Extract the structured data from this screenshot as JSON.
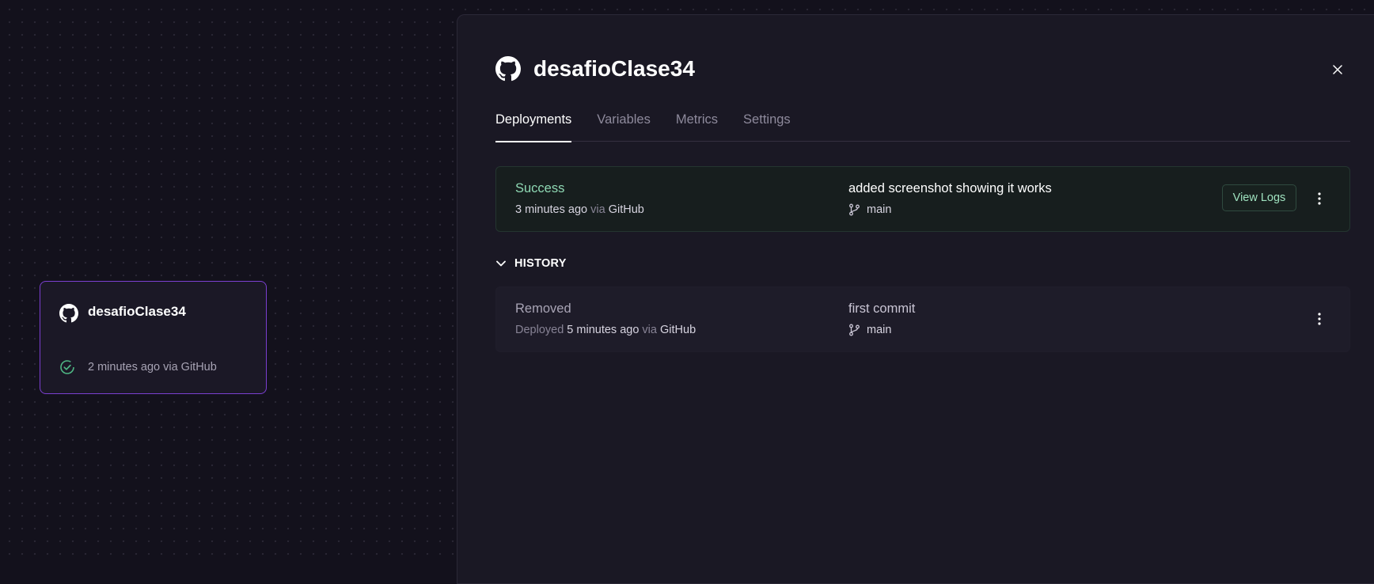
{
  "colors": {
    "success": "#8fd9b4",
    "accent_border": "#7b3fd0",
    "removed": "#a8a4b5"
  },
  "service_card": {
    "name": "desafioClase34",
    "icon": "github-icon",
    "status_icon": "check-circle-icon",
    "meta": "2 minutes ago via GitHub"
  },
  "panel": {
    "title": "desafioClase34",
    "icon": "github-icon",
    "tabs": [
      {
        "label": "Deployments",
        "active": true
      },
      {
        "label": "Variables",
        "active": false
      },
      {
        "label": "Metrics",
        "active": false
      },
      {
        "label": "Settings",
        "active": false
      }
    ],
    "active_deployment": {
      "status": "Success",
      "time": "3 minutes ago",
      "via_word": "via",
      "source": "GitHub",
      "commit": "added screenshot showing it works",
      "branch": "main",
      "view_logs_label": "View Logs"
    },
    "history_label": "HISTORY",
    "history": [
      {
        "status": "Removed",
        "deployed_word": "Deployed",
        "time": "5 minutes ago",
        "via_word": "via",
        "source": "GitHub",
        "commit": "first commit",
        "branch": "main"
      }
    ]
  }
}
